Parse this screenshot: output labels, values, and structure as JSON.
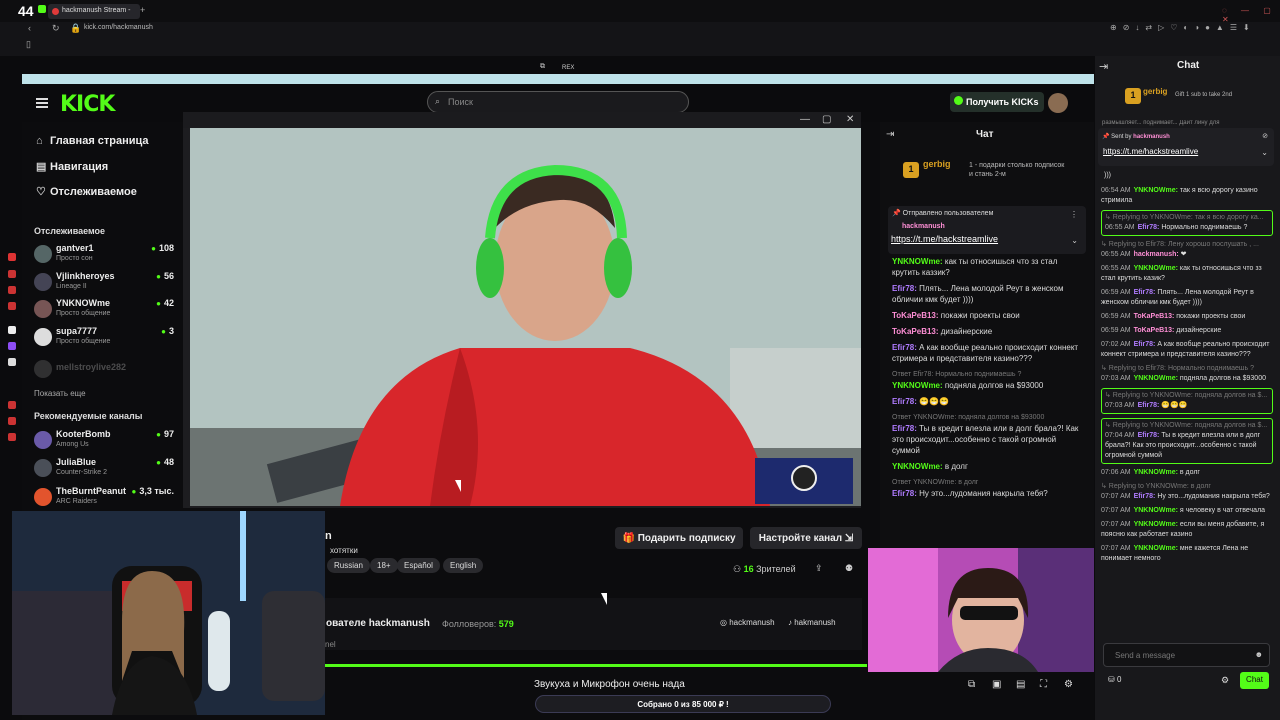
{
  "browser": {
    "counter": "44",
    "tab_title": "hackmanush Stream -",
    "new_tab": "+",
    "url": "kick.com/hackmanush",
    "top_center_label": "REX"
  },
  "header": {
    "logo": "KICK",
    "search_placeholder": "Поиск",
    "get_kicks": "Получить KICKs"
  },
  "sidebar": {
    "nav": [
      {
        "icon": "home-icon",
        "label": "Главная страница"
      },
      {
        "icon": "compass-icon",
        "label": "Навигация"
      },
      {
        "icon": "heart-icon",
        "label": "Отслеживаемое"
      }
    ],
    "followed_heading": "Отслеживаемое",
    "followed": [
      {
        "name": "gantver1",
        "sub": "Просто сон",
        "count": "108"
      },
      {
        "name": "Vjlinkheroyes",
        "sub": "Lineage II",
        "count": "56"
      },
      {
        "name": "YNKNOWme",
        "sub": "Просто общение",
        "count": "42"
      },
      {
        "name": "supa7777",
        "sub": "Просто общение",
        "count": "3"
      },
      {
        "name": "mellstroylive282",
        "sub": "",
        "count": ""
      }
    ],
    "show_more": "Показать еще",
    "recommended_heading": "Рекомендуемые каналы",
    "recommended": [
      {
        "name": "KooterBomb",
        "sub": "Among Us",
        "count": "97"
      },
      {
        "name": "JuliaBlue",
        "sub": "Counter-Strike 2",
        "count": "48"
      },
      {
        "name": "TheBurntPeanut",
        "sub": "ARC Raiders",
        "count": "3,3 тыс."
      }
    ]
  },
  "stream": {
    "gift_sub": "Подарить подписку",
    "channel_settings": "Настройте канал",
    "title_fragment": "n",
    "subtitle_fragment": "хотятки",
    "tags": [
      "Russian",
      "18+",
      "Español",
      "English"
    ],
    "viewers_count": "16",
    "viewers_label": "Зрителей",
    "about_title": "ователе hackmanush",
    "followers_label": "Фолловеров:",
    "followers_count": "579",
    "social_instagram": "hackmanush",
    "social_tiktok": "hakmanush",
    "about_fragment": "nel"
  },
  "goal": {
    "text": "Звукуха и Микрофон очень нада",
    "collected": "Собрано 0  из 85 000 ₽ !"
  },
  "chat_mid": {
    "title": "Чат",
    "gift_user": "gerbig",
    "gift_count": "1",
    "gift_text": "1 - подарки столько подписок и стань 2-м",
    "pinned_by_label": "Отправлено пользователем",
    "pinned_user": "hackmanush",
    "pinned_link": "https://t.me/hackstreamlive",
    "messages": [
      {
        "reply": "",
        "user": "YNKNOWme",
        "color": "#53fc18",
        "text": "как ты относишься что зз стал крутить каззик?"
      },
      {
        "reply": "",
        "user": "Efir78",
        "color": "#b07cff",
        "text": "Плять... Лена молодой Реут в женском обличии кмк будет ))))"
      },
      {
        "reply": "",
        "user": "ToKaPeB13",
        "color": "#ff8fd6",
        "text": "покажи проекты свои"
      },
      {
        "reply": "",
        "user": "ToKaPeB13",
        "color": "#ff8fd6",
        "text": "дизайнерские"
      },
      {
        "reply": "",
        "user": "Efir78",
        "color": "#b07cff",
        "text": "А как вообще реально происходит коннект стримера и представителя казино???"
      },
      {
        "reply": "Ответ Efir78: Нормально поднимаешь ?",
        "user": "YNKNOWme",
        "color": "#53fc18",
        "text": "подняла долгов на $93000"
      },
      {
        "reply": "",
        "user": "Efir78",
        "color": "#b07cff",
        "text": "😁😁😁"
      },
      {
        "reply": "Ответ YNKNOWme: подняла долгов на $93000",
        "user": "Efir78",
        "color": "#b07cff",
        "text": "Ты в кредит влезла или в долг брала?! Как это происходит...особенно с такой огромной суммой"
      },
      {
        "reply": "",
        "user": "YNKNOWme",
        "color": "#53fc18",
        "text": "в долг"
      },
      {
        "reply": "Ответ YNKNOWme: в долг",
        "user": "Efir78",
        "color": "#b07cff",
        "text": "Ну это...лудомания накрыла тебя?"
      }
    ]
  },
  "chat_right": {
    "title": "Chat",
    "gift_user": "gerbig",
    "gift_text": "Gift 1 sub to take 2nd",
    "top_fragment": "размышляет... поднимает... Дайт лину для",
    "sent_by_label": "Sent by",
    "pinned_user": "hackmanush",
    "pinned_link": "https://t.me/hackstreamlive",
    "fragment": ")))",
    "messages": [
      {
        "boxed": false,
        "reply": "",
        "time": "06:54 AM",
        "user": "YNKNOWme",
        "color": "#53fc18",
        "text": "так я всю дорогу казино стримила"
      },
      {
        "boxed": true,
        "reply": "Replying to YNKNOWme: так я всю дорогу ка...",
        "time": "06:55 AM",
        "user": "Efir78",
        "color": "#b07cff",
        "text": "Нормально поднимаешь ?"
      },
      {
        "boxed": false,
        "reply": "Replying to Efir78: Лену хорошо послушать , ...",
        "time": "06:55 AM",
        "user": "hackmanush",
        "color": "#ff8fd6",
        "text": "❤"
      },
      {
        "boxed": false,
        "reply": "",
        "time": "06:55 AM",
        "user": "YNKNOWme",
        "color": "#53fc18",
        "text": "как ты относишься что зз стал крутить казик?"
      },
      {
        "boxed": false,
        "reply": "",
        "time": "06:59 AM",
        "user": "Efir78",
        "color": "#b07cff",
        "text": "Плять... Лена молодой Реут в женском обличии кмк будет ))))"
      },
      {
        "boxed": false,
        "reply": "",
        "time": "06:59 AM",
        "user": "ToKaPeB13",
        "color": "#ff8fd6",
        "text": "покажи проекты свои"
      },
      {
        "boxed": false,
        "reply": "",
        "time": "06:59 AM",
        "user": "ToKaPeB13",
        "color": "#ff8fd6",
        "text": "дизайнерские"
      },
      {
        "boxed": false,
        "reply": "",
        "time": "07:02 AM",
        "user": "Efir78",
        "color": "#b07cff",
        "text": "А как вообще реально происходит коннект стримера и представителя казино???"
      },
      {
        "boxed": false,
        "reply": "Replying to Efir78: Нормально поднимаешь ?",
        "time": "07:03 AM",
        "user": "YNKNOWme",
        "color": "#53fc18",
        "text": "подняла долгов на $93000"
      },
      {
        "boxed": true,
        "reply": "Replying to YNKNOWme: подняла долгов на $...",
        "time": "07:03 AM",
        "user": "Efir78",
        "color": "#b07cff",
        "text": "😁😁😁"
      },
      {
        "boxed": true,
        "reply": "Replying to YNKNOWme: подняла долгов на $...",
        "time": "07:04 AM",
        "user": "Efir78",
        "color": "#b07cff",
        "text": "Ты в кредит влезла или в долг брала?! Как это происходит...особенно с такой огромной суммой"
      },
      {
        "boxed": false,
        "reply": "",
        "time": "07:06 AM",
        "user": "YNKNOWme",
        "color": "#53fc18",
        "text": "в долг"
      },
      {
        "boxed": false,
        "reply": "Replying to YNKNOWme: в долг",
        "time": "07:07 AM",
        "user": "Efir78",
        "color": "#b07cff",
        "text": "Ну это...лудомания накрыла тебя?"
      },
      {
        "boxed": false,
        "reply": "",
        "time": "07:07 AM",
        "user": "YNKNOWme",
        "color": "#53fc18",
        "text": "я человеку в чат отвечала"
      },
      {
        "boxed": false,
        "reply": "",
        "time": "07:07 AM",
        "user": "YNKNOWme",
        "color": "#53fc18",
        "text": "если вы меня добавите, я поясню как работает казино"
      },
      {
        "boxed": false,
        "reply": "",
        "time": "07:07 AM",
        "user": "YNKNOWme",
        "color": "#53fc18",
        "text": "мне кажется Лена не понимает немного"
      }
    ],
    "send_placeholder": "Send a message",
    "kicks_count": "0",
    "chat_button": "Chat"
  },
  "colors": {
    "accent": "#53fc18",
    "gift": "#d9a021"
  }
}
